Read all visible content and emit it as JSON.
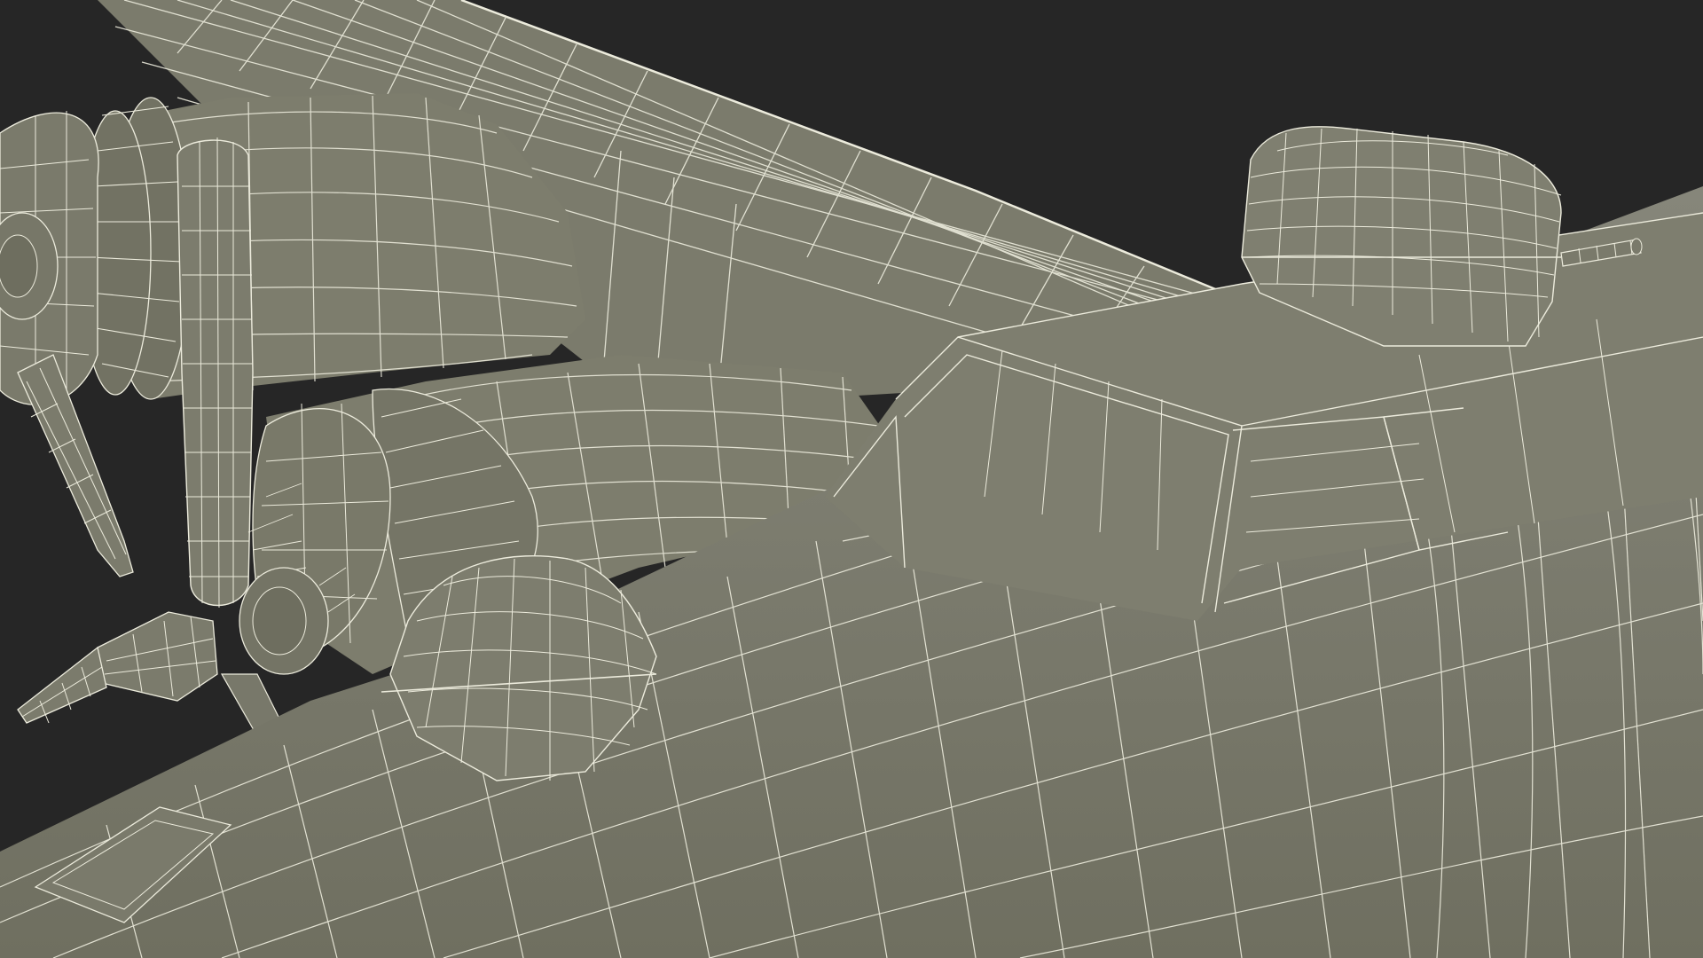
{
  "viewport": {
    "background_color": "#262626",
    "surface_color": "#7c7c6c",
    "surface_shade_color": "#6f6f60",
    "surface_light_color": "#86867a",
    "wire_color": "#ecebdc"
  },
  "scene": {
    "subject": "aircraft-wireframe-model",
    "visible_parts": [
      "wing",
      "engine-nacelle-outer",
      "engine-nacelle-inner",
      "propeller-outer",
      "propeller-inner",
      "fuselage",
      "cockpit-canopy",
      "top-turret",
      "front-dome",
      "machine-gun-barrel"
    ]
  }
}
